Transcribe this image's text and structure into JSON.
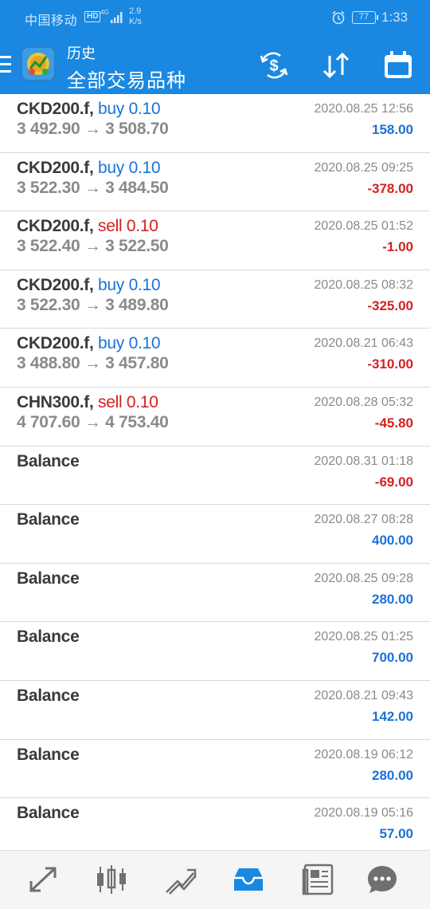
{
  "status_bar": {
    "carrier": "中国移动",
    "hd": "HD",
    "network": "4G",
    "speed_value": "2.9",
    "speed_unit": "K/s",
    "battery": "77",
    "time": "1:33"
  },
  "app_bar": {
    "subtitle": "历史",
    "title": "全部交易品种"
  },
  "history": [
    {
      "symbol": "CKD200.f,",
      "direction": "buy",
      "volume": "0.10",
      "open": "3 492.90",
      "close": "3 508.70",
      "date": "2020.08.25 12:56",
      "profit": "158.00",
      "sign": "pos"
    },
    {
      "symbol": "CKD200.f,",
      "direction": "buy",
      "volume": "0.10",
      "open": "3 522.30",
      "close": "3 484.50",
      "date": "2020.08.25 09:25",
      "profit": "-378.00",
      "sign": "neg"
    },
    {
      "symbol": "CKD200.f,",
      "direction": "sell",
      "volume": "0.10",
      "open": "3 522.40",
      "close": "3 522.50",
      "date": "2020.08.25 01:52",
      "profit": "-1.00",
      "sign": "neg"
    },
    {
      "symbol": "CKD200.f,",
      "direction": "buy",
      "volume": "0.10",
      "open": "3 522.30",
      "close": "3 489.80",
      "date": "2020.08.25 08:32",
      "profit": "-325.00",
      "sign": "neg"
    },
    {
      "symbol": "CKD200.f,",
      "direction": "buy",
      "volume": "0.10",
      "open": "3 488.80",
      "close": "3 457.80",
      "date": "2020.08.21 06:43",
      "profit": "-310.00",
      "sign": "neg"
    },
    {
      "symbol": "CHN300.f,",
      "direction": "sell",
      "volume": "0.10",
      "open": "4 707.60",
      "close": "4 753.40",
      "date": "2020.08.28 05:32",
      "profit": "-45.80",
      "sign": "neg"
    },
    {
      "symbol": "Balance",
      "date": "2020.08.31 01:18",
      "profit": "-69.00",
      "sign": "neg"
    },
    {
      "symbol": "Balance",
      "date": "2020.08.27 08:28",
      "profit": "400.00",
      "sign": "pos"
    },
    {
      "symbol": "Balance",
      "date": "2020.08.25 09:28",
      "profit": "280.00",
      "sign": "pos"
    },
    {
      "symbol": "Balance",
      "date": "2020.08.25 01:25",
      "profit": "700.00",
      "sign": "pos"
    },
    {
      "symbol": "Balance",
      "date": "2020.08.21 09:43",
      "profit": "142.00",
      "sign": "pos"
    },
    {
      "symbol": "Balance",
      "date": "2020.08.19 06:12",
      "profit": "280.00",
      "sign": "pos"
    },
    {
      "symbol": "Balance",
      "date": "2020.08.19 05:16",
      "profit": "57.00",
      "sign": "pos"
    }
  ],
  "bottom_nav": [
    {
      "icon": "quotes-icon",
      "active": false
    },
    {
      "icon": "chart-icon",
      "active": false
    },
    {
      "icon": "trade-icon",
      "active": false
    },
    {
      "icon": "history-icon",
      "active": true
    },
    {
      "icon": "news-icon",
      "active": false
    },
    {
      "icon": "chat-icon",
      "active": false
    }
  ],
  "colors": {
    "brand_blue": "#1a88e0",
    "buy_blue": "#1a72d8",
    "sell_red": "#d42020",
    "nav_gray": "#707070"
  }
}
